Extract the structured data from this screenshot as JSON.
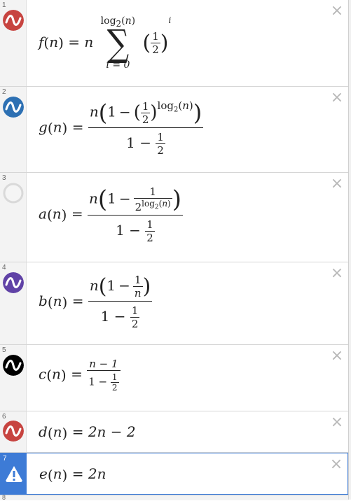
{
  "rows": [
    {
      "index": "1",
      "color": "#c74440",
      "icon": "wave-icon"
    },
    {
      "index": "2",
      "color": "#2d70b3",
      "icon": "wave-icon"
    },
    {
      "index": "3",
      "color": "#d9d9d9",
      "icon": "hidden-circle-icon"
    },
    {
      "index": "4",
      "color": "#6042a6",
      "icon": "wave-icon"
    },
    {
      "index": "5",
      "color": "#000000",
      "icon": "wave-icon"
    },
    {
      "index": "6",
      "color": "#c74440",
      "icon": "wave-icon"
    },
    {
      "index": "7",
      "color": "#3d7bd6",
      "icon": "warning-icon"
    },
    {
      "index": "8"
    }
  ],
  "close_symbol": "×",
  "expr": {
    "f": {
      "lhs": "f",
      "arg": "n",
      "coef": "n",
      "upper": "log",
      "upper_sub": "2",
      "upper_arg": "n",
      "lower": "i = 0",
      "frac_num": "1",
      "frac_den": "2",
      "power": "i"
    },
    "g": {
      "lhs": "g",
      "arg": "n",
      "outer": "n",
      "one": "1",
      "minus": "−",
      "fn": "1",
      "fd": "2",
      "pow": "log",
      "pow_sub": "2",
      "pow_arg": "n",
      "den_one": "1",
      "den_num": "1",
      "den_den": "2"
    },
    "a": {
      "lhs": "a",
      "arg": "n",
      "outer": "n",
      "one": "1",
      "minus": "−",
      "inner_num": "1",
      "base": "2",
      "pow": "log",
      "pow_sub": "2",
      "pow_arg": "n",
      "den_one": "1",
      "den_num": "1",
      "den_den": "2"
    },
    "b": {
      "lhs": "b",
      "arg": "n",
      "outer": "n",
      "one": "1",
      "minus": "−",
      "inner_num": "1",
      "inner_den": "n",
      "den_one": "1",
      "den_num": "1",
      "den_den": "2"
    },
    "c": {
      "lhs": "c",
      "arg": "n",
      "num": "n − 1",
      "den_one": "1",
      "den_num": "1",
      "den_den": "2"
    },
    "d": {
      "lhs": "d",
      "arg": "n",
      "rhs": "2n − 2"
    },
    "e": {
      "lhs": "e",
      "arg": "n",
      "rhs": "2n"
    }
  }
}
